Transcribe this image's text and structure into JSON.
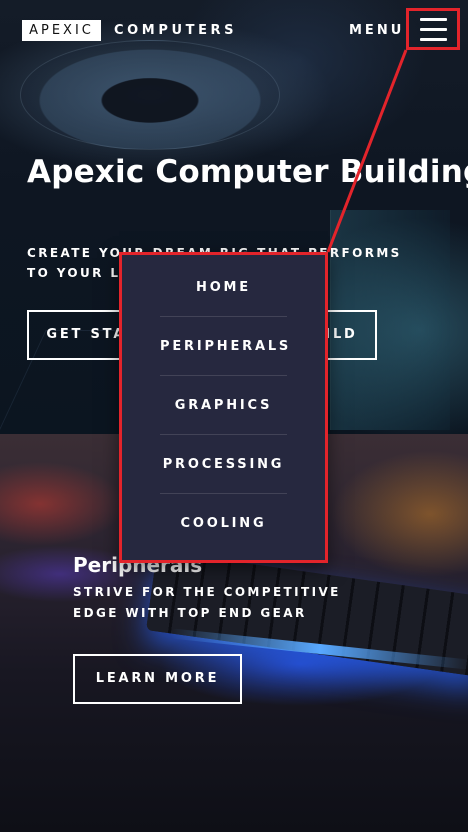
{
  "header": {
    "logo_box": "APEXIC",
    "logo_rest": "COMPUTERS",
    "menu_label": "MENU"
  },
  "hero": {
    "title": "Apexic Computer Building",
    "subtitle": "CREATE YOUR DREAM RIG THAT PERFORMS TO YOUR LIKING",
    "cta_label": "GET STARTED WITH YOUR BUILD"
  },
  "section2": {
    "title": "Peripherals",
    "subtitle": "STRIVE FOR THE COMPETITIVE EDGE WITH TOP END GEAR",
    "cta_label": "LEARN MORE"
  },
  "menu": {
    "items": [
      {
        "label": "HOME"
      },
      {
        "label": "PERIPHERALS"
      },
      {
        "label": "GRAPHICS"
      },
      {
        "label": "PROCESSING"
      },
      {
        "label": "COOLING"
      }
    ]
  },
  "colors": {
    "highlight": "#e3242b",
    "menu_bg": "#26283f"
  },
  "icons": {
    "menu": "hamburger-icon"
  }
}
